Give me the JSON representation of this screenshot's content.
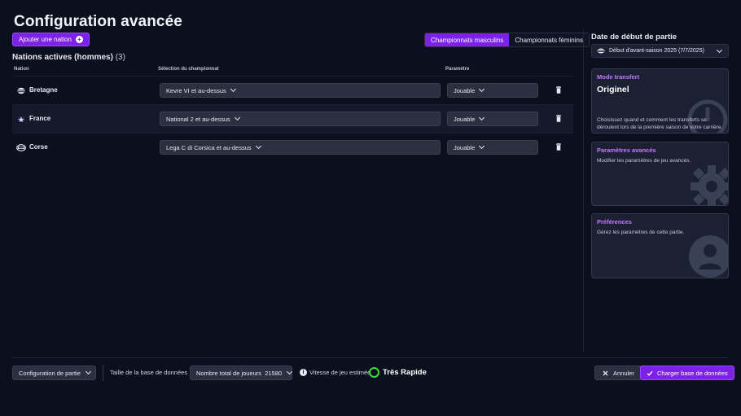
{
  "page": {
    "title": "Configuration avancée"
  },
  "toolbar": {
    "add_nation_label": "Ajouter une nation",
    "gender_tabs": [
      {
        "label": "Championnats masculins",
        "active": true
      },
      {
        "label": "Championnats féminins",
        "active": false
      }
    ]
  },
  "nations": {
    "heading": "Nations actives (hommes)",
    "count": "(3)",
    "columns": {
      "nation": "Nation",
      "league": "Sélection du championnat",
      "param": "Paramètre"
    },
    "rows": [
      {
        "name": "Bretagne",
        "league": "Kevre VI et au-dessus",
        "param": "Jouable",
        "flag": "bretagne-flag-icon"
      },
      {
        "name": "France",
        "league": "National 2 et au-dessus",
        "param": "Jouable",
        "flag": "france-flag-icon"
      },
      {
        "name": "Corse",
        "league": "Lega C di Corsica et au-dessus",
        "param": "Jouable",
        "flag": "corse-flag-icon"
      }
    ]
  },
  "sidebar": {
    "date_title": "Date de début de partie",
    "date_value": "Début d'avant-saison 2025 (7/7/2025)",
    "cards": [
      {
        "label": "Mode transfert",
        "big": "Originel",
        "desc": "Choisissez quand et comment les transferts se déroulent lors de la première saison de votre carrière.",
        "icon": "clock-icon"
      },
      {
        "label": "Paramètres avancés",
        "big": "",
        "desc": "Modifier les paramètres de jeu avancés.",
        "icon": "gear-icon"
      },
      {
        "label": "Préférences",
        "big": "",
        "desc": "Gérez les paramètres de cette partie.",
        "icon": "user-icon"
      }
    ]
  },
  "footer": {
    "config_label": "Configuration de partie",
    "db_size_label": "Taille de la base de données",
    "players_select": "Nombre total de joueurs  21580",
    "speed_label": "Vitesse de jeu estimée",
    "speed_value": "Très Rapide",
    "cancel_label": "Annuler",
    "load_label": "Charger base de données"
  },
  "colors": {
    "accent": "#7c22e8",
    "speed": "#3ddc3d",
    "card_label": "#c47bff"
  }
}
